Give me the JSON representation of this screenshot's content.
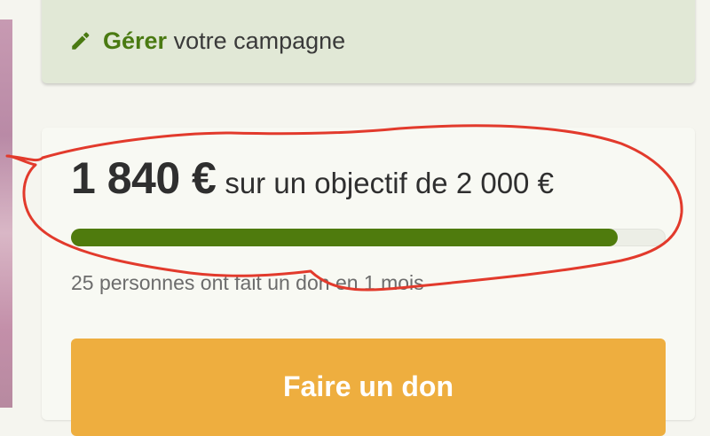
{
  "manage": {
    "strong": "Gérer",
    "rest": "votre campagne",
    "icon": "pencil-icon"
  },
  "funding": {
    "raised": "1 840 €",
    "goal_text": "sur un objectif de 2 000 €",
    "progress_fraction": 0.92,
    "donors_text": "25 personnes ont fait un don en 1 mois"
  },
  "donate_button": {
    "label": "Faire un don"
  },
  "colors": {
    "accent_green": "#4f7b0d",
    "button_orange": "#eeae3f",
    "annotation_red": "#e23a2c"
  }
}
